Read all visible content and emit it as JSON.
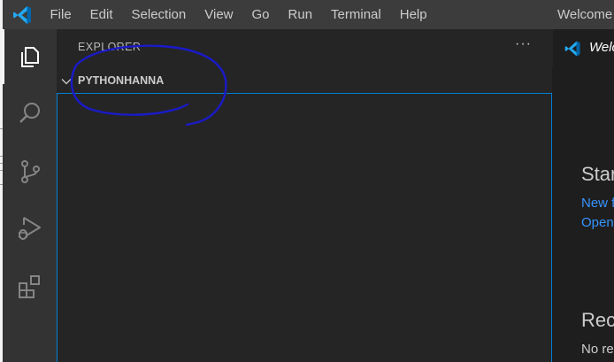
{
  "menu": {
    "items": [
      "File",
      "Edit",
      "Selection",
      "View",
      "Go",
      "Run",
      "Terminal",
      "Help"
    ]
  },
  "window": {
    "title": "Welcome"
  },
  "activity_bar": {
    "items": [
      {
        "icon": "explorer-icon",
        "active": true
      },
      {
        "icon": "search-icon",
        "active": false
      },
      {
        "icon": "source-control-icon",
        "active": false
      },
      {
        "icon": "run-debug-icon",
        "active": false
      },
      {
        "icon": "extensions-icon",
        "active": false
      }
    ]
  },
  "sidebar": {
    "title": "EXPLORER",
    "more_actions": "···",
    "folder_name": "PYTHONHANNA"
  },
  "editor": {
    "tab_label": "Welcome",
    "start_heading": "Start",
    "new_file_link": "New file...",
    "open_link": "Open folder...",
    "recent_heading": "Recent",
    "no_recent_text": "No recent folders"
  },
  "colors": {
    "accent": "#007fd4",
    "link": "#3794ff",
    "vscode_blue": "#0065a9",
    "annotation_ink": "#1a1ac8"
  }
}
